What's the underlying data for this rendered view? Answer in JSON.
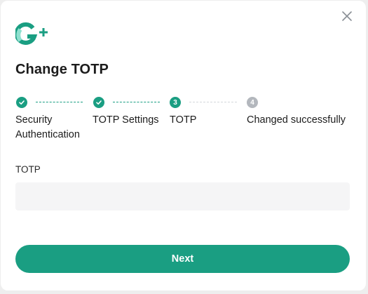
{
  "dialog": {
    "title": "Change TOTP",
    "close_icon": "close-icon",
    "logo_icon": "g-plus-logo"
  },
  "steps": [
    {
      "label": "Security Authentication",
      "status": "done",
      "marker": "check-icon"
    },
    {
      "label": "TOTP Settings",
      "status": "done",
      "marker": "check-icon"
    },
    {
      "label": "TOTP",
      "status": "current",
      "marker": "3"
    },
    {
      "label": "Changed successfully",
      "status": "pending",
      "marker": "4"
    }
  ],
  "form": {
    "totp_label": "TOTP",
    "totp_value": "",
    "totp_placeholder": ""
  },
  "actions": {
    "next_label": "Next"
  },
  "colors": {
    "accent": "#1a9e82",
    "pending": "#b3b7bd",
    "input_bg": "#f5f5f6",
    "logo_light": "#8fe0cf"
  }
}
